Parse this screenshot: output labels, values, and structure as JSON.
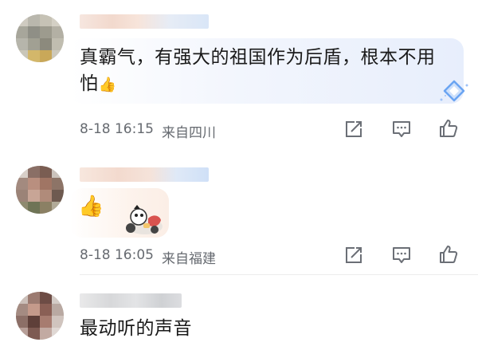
{
  "comments": [
    {
      "avatar": "blurred-avatar",
      "text_line1": "真霸气，有强大的祖国作为后盾，根本不用",
      "text_line2": "怕",
      "emoji": "👍",
      "time": "8-18 16:15",
      "location": "来自四川",
      "actions": [
        "share-icon",
        "comment-icon",
        "like-icon"
      ]
    },
    {
      "avatar": "blurred-avatar",
      "emoji": "👍",
      "time": "8-18 16:05",
      "location": "来自福建",
      "actions": [
        "share-icon",
        "comment-icon",
        "like-icon"
      ]
    },
    {
      "avatar": "blurred-avatar",
      "text_line1": "最动听的声音"
    }
  ],
  "colors": {
    "meta_text": "#666a70",
    "icon_stroke": "#6b6f76",
    "bubble_blue": "#e8efff",
    "bubble_peach": "#fdf0e6"
  }
}
